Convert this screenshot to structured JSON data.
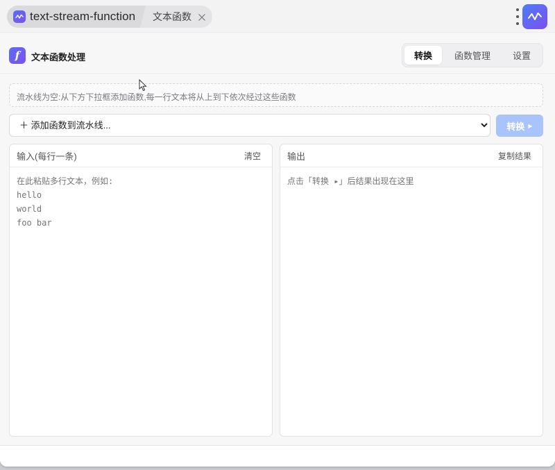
{
  "titlebar": {
    "tab_title": "text-stream-function",
    "sub_tab": "文本函数",
    "brand_color": "#6a5cf3"
  },
  "header": {
    "logo_glyph": "f",
    "title": "文本函数处理",
    "nav": [
      {
        "label": "转换",
        "active": true
      },
      {
        "label": "函数管理",
        "active": false
      },
      {
        "label": "设置",
        "active": false
      }
    ]
  },
  "pipeline": {
    "hint": "流水线为空:从下方下拉框添加函数,每一行文本将从上到下依次经过这些函数",
    "add_select_label": "＋ 添加函数到流水线...",
    "convert_label": "转换",
    "convert_color": "#a9c4fa"
  },
  "input_panel": {
    "title": "输入(每行一条)",
    "clear_label": "清空",
    "placeholder": "在此粘贴多行文本，例如:\nhello\nworld\nfoo bar"
  },
  "output_panel": {
    "title": "输出",
    "copy_label": "复制结果",
    "placeholder": "点击「转换 ▸」后结果出现在这里"
  }
}
